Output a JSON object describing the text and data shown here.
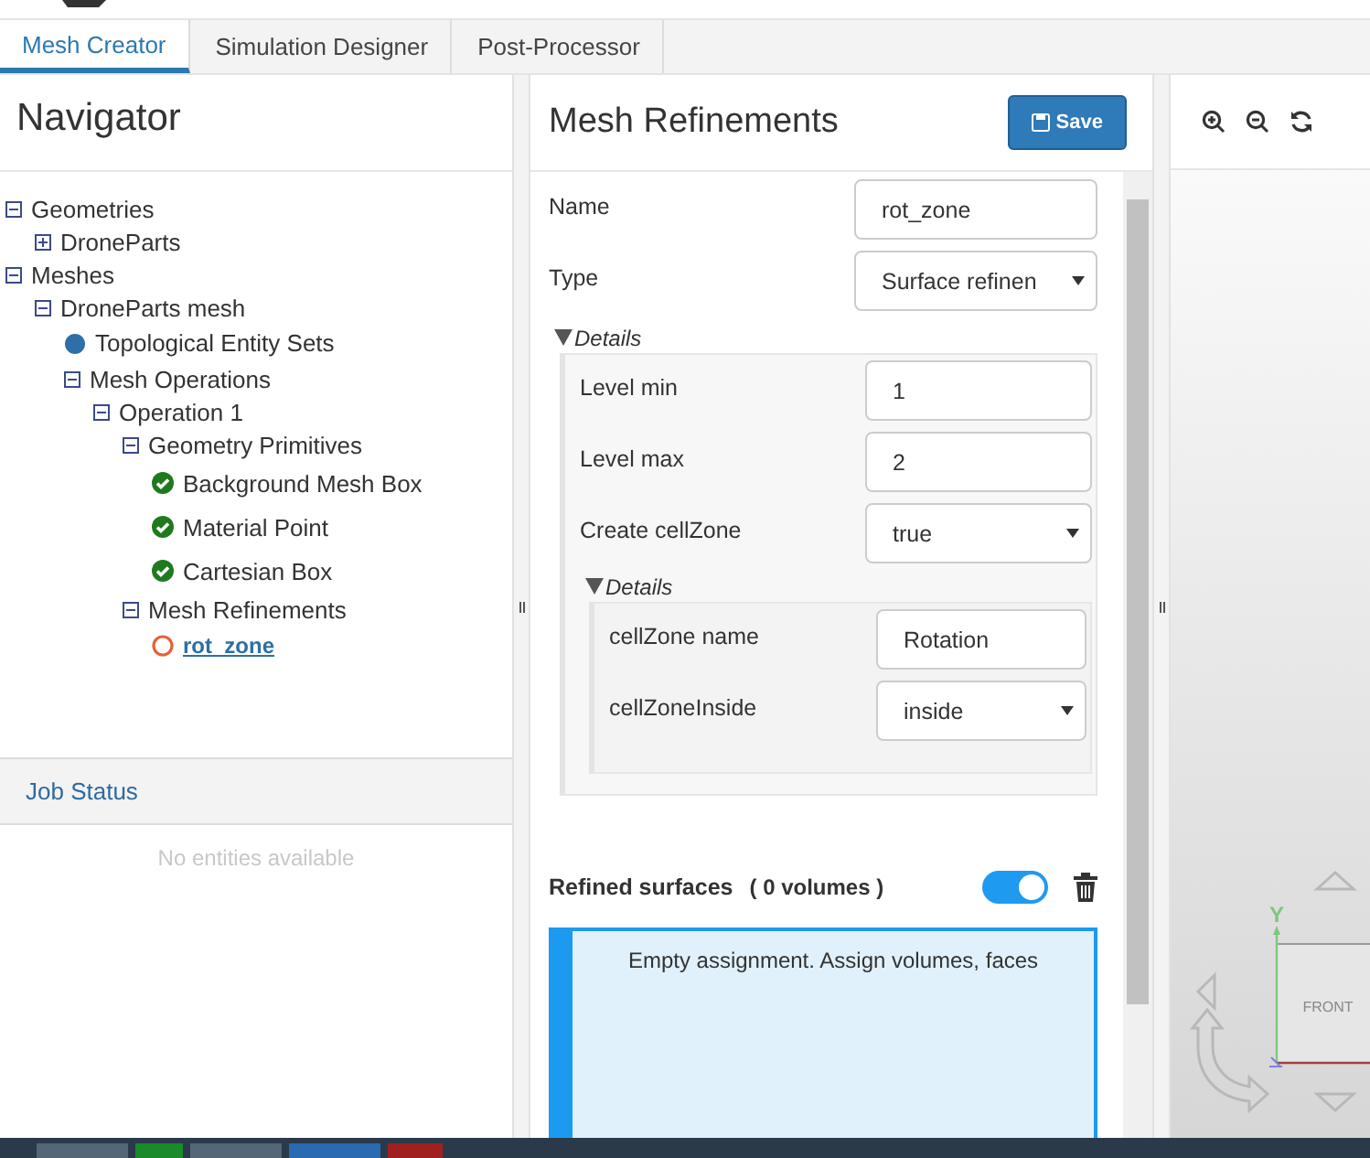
{
  "tabs": [
    {
      "label": "Mesh Creator",
      "selected": true
    },
    {
      "label": "Simulation Designer",
      "selected": false
    },
    {
      "label": "Post-Processor",
      "selected": false
    }
  ],
  "navigator": {
    "title": "Navigator",
    "tree": [
      {
        "label": "Geometries",
        "kind": "group",
        "expanded": true,
        "children": [
          {
            "label": "DroneParts",
            "kind": "group",
            "expanded": false
          }
        ]
      },
      {
        "label": "Meshes",
        "kind": "group",
        "expanded": true,
        "children": [
          {
            "label": "DroneParts mesh",
            "kind": "group",
            "expanded": true,
            "children": [
              {
                "label": "Topological Entity Sets",
                "kind": "entity-set"
              },
              {
                "label": "Mesh Operations",
                "kind": "group",
                "expanded": true,
                "children": [
                  {
                    "label": "Operation 1",
                    "kind": "group",
                    "expanded": true,
                    "children": [
                      {
                        "label": "Geometry Primitives",
                        "kind": "group",
                        "expanded": true,
                        "children": [
                          {
                            "label": "Background Mesh Box",
                            "kind": "valid"
                          },
                          {
                            "label": "Material Point",
                            "kind": "valid"
                          },
                          {
                            "label": "Cartesian Box",
                            "kind": "valid"
                          }
                        ]
                      },
                      {
                        "label": "Mesh Refinements",
                        "kind": "group",
                        "expanded": true,
                        "children": [
                          {
                            "label": "rot_zone",
                            "kind": "pending"
                          }
                        ]
                      }
                    ]
                  }
                ]
              }
            ]
          }
        ]
      }
    ]
  },
  "job_status": {
    "title": "Job Status",
    "empty_message": "No entities available"
  },
  "editor": {
    "title": "Mesh Refinements",
    "save_button": "Save",
    "fields": [
      {
        "label": "Name",
        "kind": "text",
        "value": "rot_zone"
      },
      {
        "label": "Type",
        "kind": "select",
        "value": "Surface refinen"
      }
    ],
    "details": {
      "label": "Details",
      "expanded": true,
      "fields": [
        {
          "label": "Level min",
          "kind": "text",
          "value": "1"
        },
        {
          "label": "Level max",
          "kind": "text",
          "value": "2"
        },
        {
          "label": "Create cellZone",
          "kind": "select",
          "value": "true"
        }
      ],
      "details": {
        "label": "Details",
        "expanded": true,
        "fields": [
          {
            "label": "cellZone name",
            "kind": "text",
            "value": "Rotation"
          },
          {
            "label": "cellZoneInside",
            "kind": "select",
            "value": "inside"
          }
        ]
      }
    },
    "assignment": {
      "label": "Refined surfaces",
      "count": "( 0 volumes )",
      "on": true,
      "message": "Empty assignment. Assign volumes, faces"
    }
  },
  "viewer": {
    "cube_face": "FRONT",
    "axis_label": "Y"
  }
}
